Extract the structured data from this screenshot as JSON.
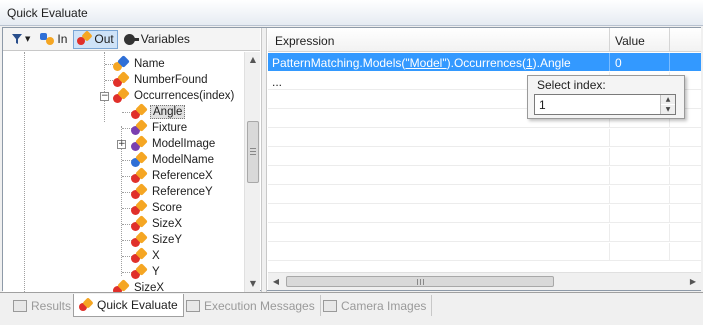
{
  "window": {
    "title": "Quick Evaluate"
  },
  "toolbar": {
    "filter_label": "",
    "in_label": "In",
    "out_label": "Out",
    "variables_label": "Variables"
  },
  "tree": {
    "nodes": [
      {
        "label": "Name"
      },
      {
        "label": "NumberFound"
      },
      {
        "label": "Occurrences(index)"
      },
      {
        "label": "Angle"
      },
      {
        "label": "Fixture"
      },
      {
        "label": "ModelImage"
      },
      {
        "label": "ModelName"
      },
      {
        "label": "ReferenceX"
      },
      {
        "label": "ReferenceY"
      },
      {
        "label": "Score"
      },
      {
        "label": "SizeX"
      },
      {
        "label": "SizeY"
      },
      {
        "label": "X"
      },
      {
        "label": "Y"
      },
      {
        "label": "SizeX"
      }
    ]
  },
  "grid": {
    "headers": {
      "expression": "Expression",
      "value": "Value"
    },
    "rows": [
      {
        "expr_prefix": "PatternMatching.Models(",
        "expr_model": "\"Model\"",
        "expr_mid": ").Occurrences(",
        "expr_index": "1",
        "expr_suffix": ").Angle",
        "value": "0"
      },
      {
        "expression": "...",
        "value": ""
      }
    ]
  },
  "popup": {
    "title": "Select index:",
    "value": "1"
  },
  "tabs": [
    {
      "label": "Results"
    },
    {
      "label": "Quick Evaluate"
    },
    {
      "label": "Execution Messages"
    },
    {
      "label": "Camera Images"
    }
  ],
  "colors": {
    "selection": "#3399ff",
    "orange": "#f5a623",
    "blue": "#2f6fd6",
    "red": "#e0302a",
    "purple": "#7a3fb0"
  }
}
